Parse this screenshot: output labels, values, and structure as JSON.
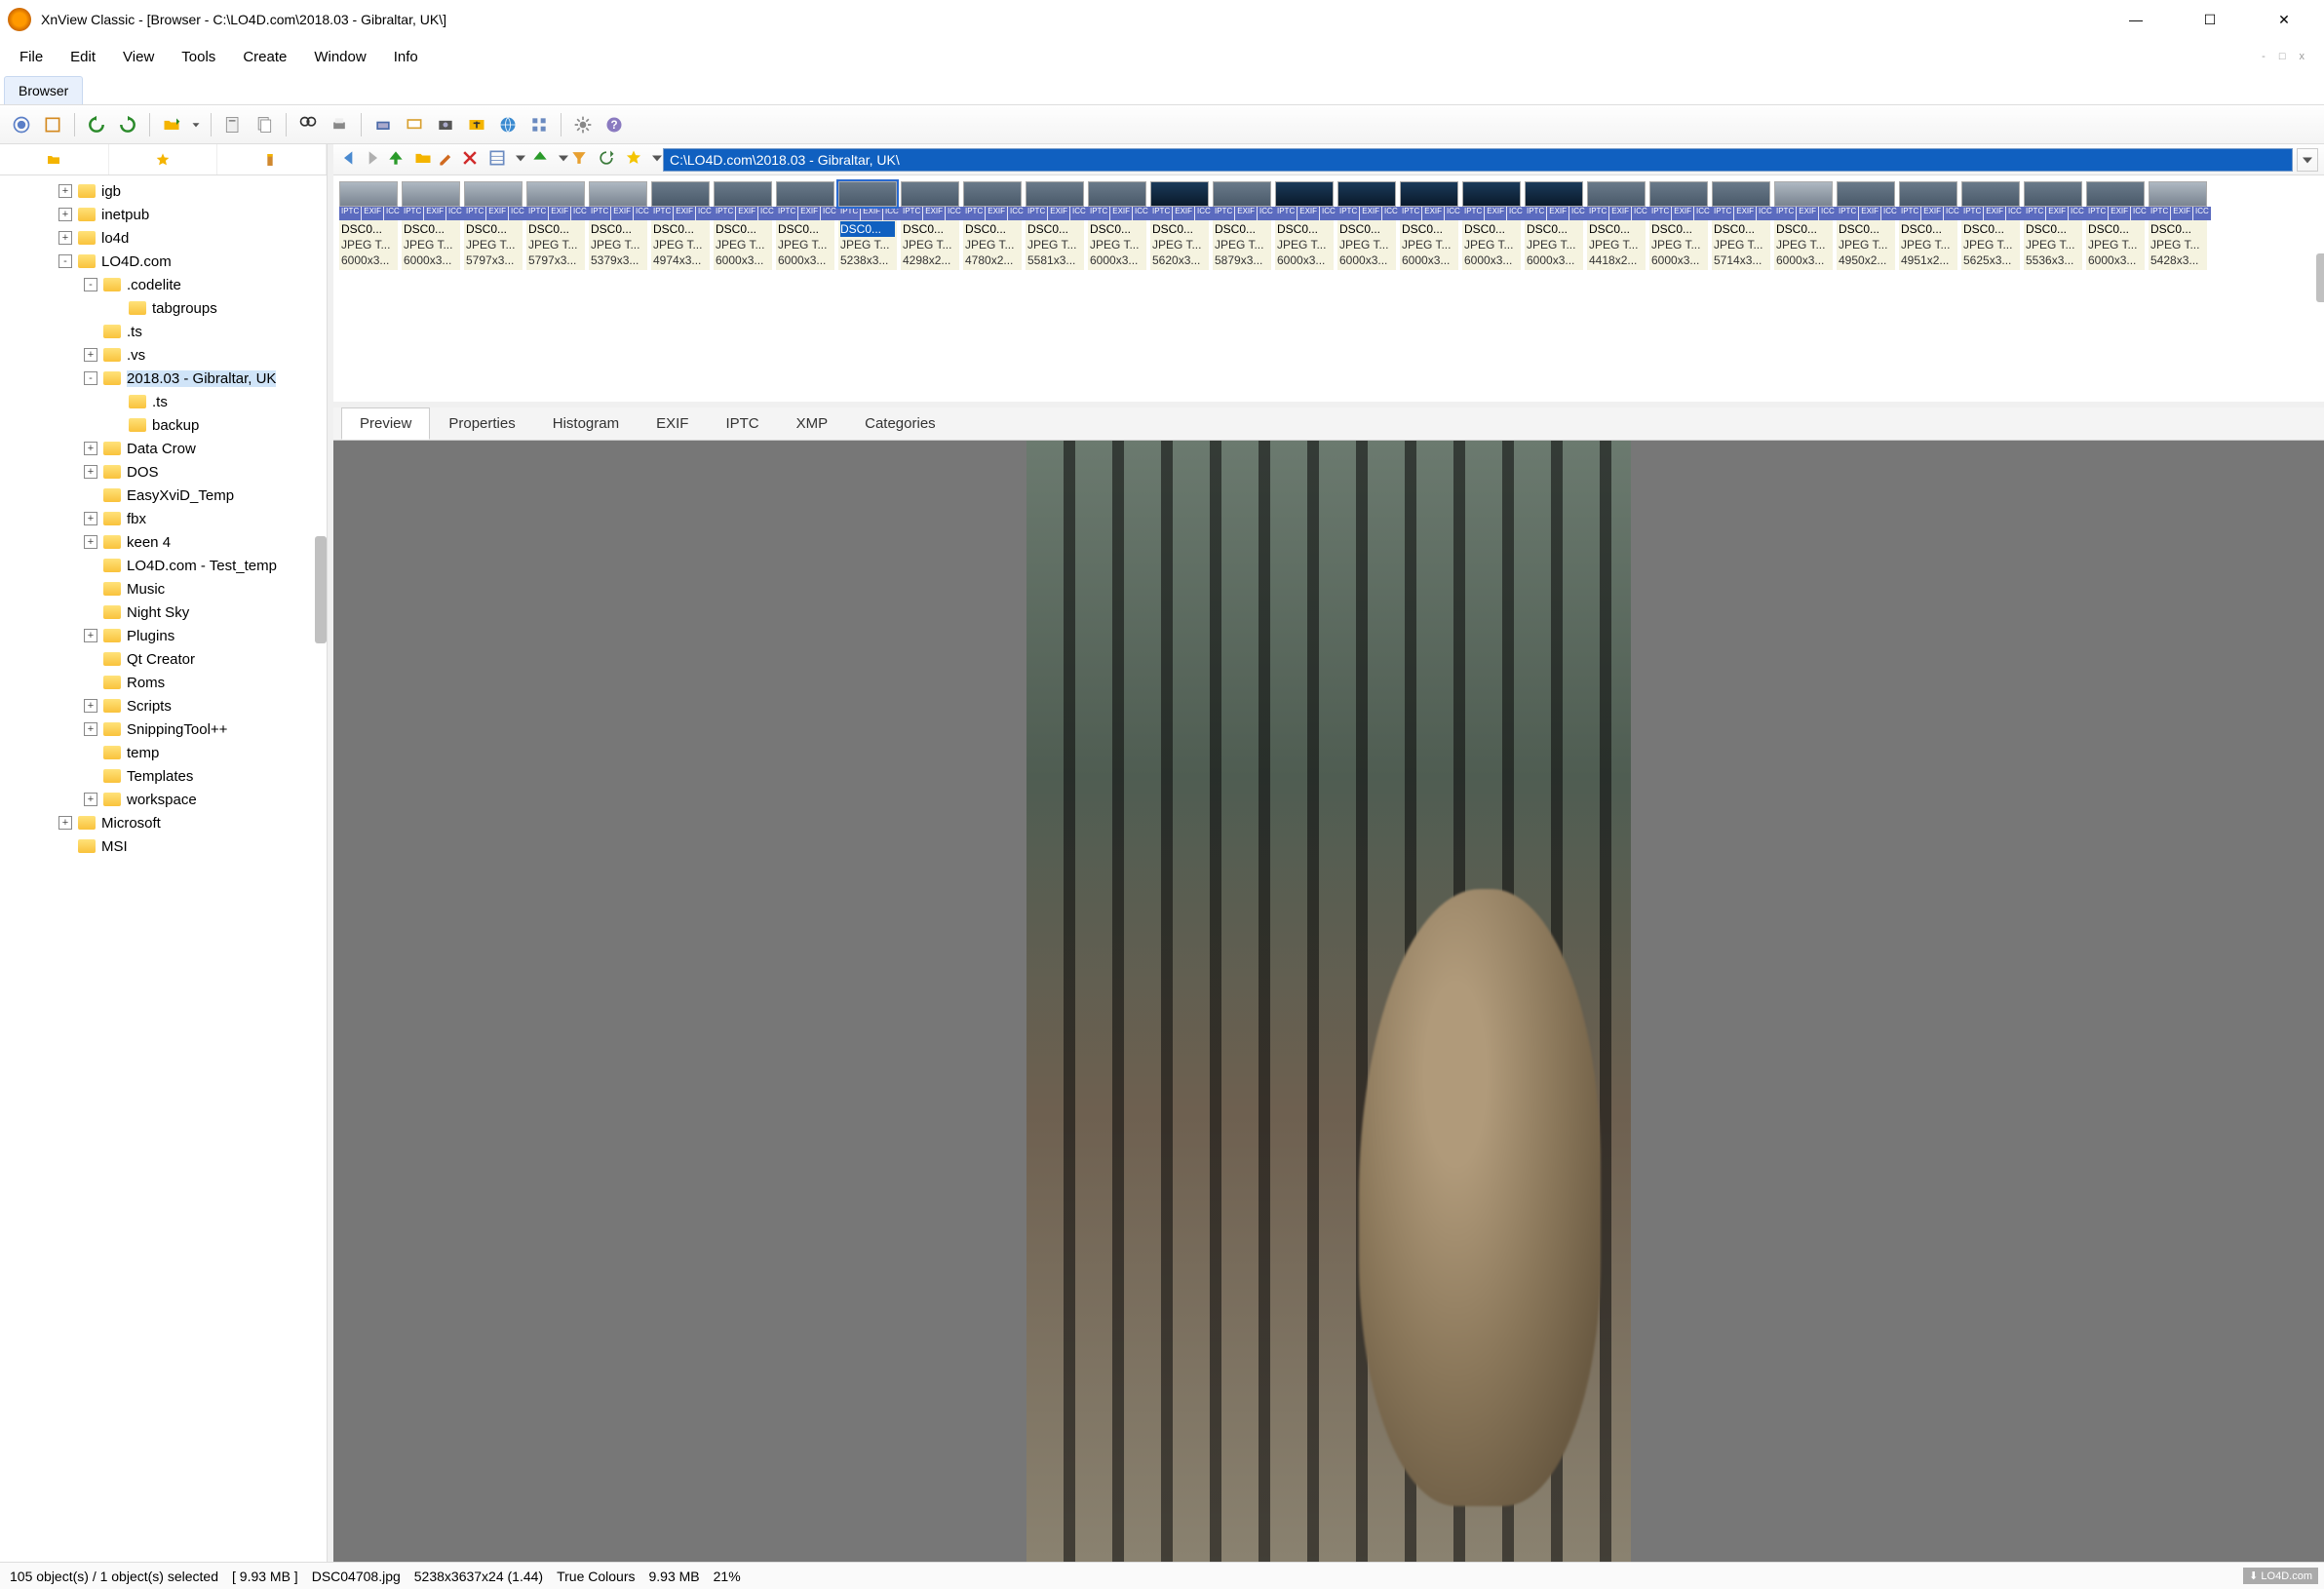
{
  "window": {
    "title": "XnView Classic - [Browser - C:\\LO4D.com\\2018.03 - Gibraltar, UK\\]",
    "minimize": "—",
    "maximize": "☐",
    "close": "✕"
  },
  "menu": {
    "items": [
      "File",
      "Edit",
      "View",
      "Tools",
      "Create",
      "Window",
      "Info"
    ],
    "miniBtns": [
      "-",
      "□",
      "x"
    ]
  },
  "tab": {
    "label": "Browser"
  },
  "toolbarIcons": [
    "view-icon",
    "fullscreen-icon",
    "rotate-ccw-icon",
    "rotate-cw-icon",
    "open-icon",
    "save-icon",
    "copy-icon",
    "search-icon",
    "print-icon",
    "scan-icon",
    "slideshow-icon",
    "capture-icon",
    "convert-icon",
    "web-icon",
    "grid-icon",
    "settings-icon",
    "help-icon"
  ],
  "shortcuts": [
    "folder",
    "star",
    "bookmark"
  ],
  "tree": [
    {
      "indent": 60,
      "toggle": "+",
      "label": "igb"
    },
    {
      "indent": 60,
      "toggle": "+",
      "label": "inetpub"
    },
    {
      "indent": 60,
      "toggle": "+",
      "label": "lo4d"
    },
    {
      "indent": 60,
      "toggle": "-",
      "label": "LO4D.com"
    },
    {
      "indent": 86,
      "toggle": "-",
      "label": ".codelite"
    },
    {
      "indent": 112,
      "toggle": "",
      "label": "tabgroups"
    },
    {
      "indent": 86,
      "toggle": "",
      "label": ".ts"
    },
    {
      "indent": 86,
      "toggle": "+",
      "label": ".vs"
    },
    {
      "indent": 86,
      "toggle": "-",
      "label": "2018.03 - Gibraltar, UK",
      "selected": true
    },
    {
      "indent": 112,
      "toggle": "",
      "label": ".ts"
    },
    {
      "indent": 112,
      "toggle": "",
      "label": "backup"
    },
    {
      "indent": 86,
      "toggle": "+",
      "label": "Data Crow"
    },
    {
      "indent": 86,
      "toggle": "+",
      "label": "DOS"
    },
    {
      "indent": 86,
      "toggle": "",
      "label": "EasyXviD_Temp"
    },
    {
      "indent": 86,
      "toggle": "+",
      "label": "fbx"
    },
    {
      "indent": 86,
      "toggle": "+",
      "label": "keen 4"
    },
    {
      "indent": 86,
      "toggle": "",
      "label": "LO4D.com - Test_temp"
    },
    {
      "indent": 86,
      "toggle": "",
      "label": "Music"
    },
    {
      "indent": 86,
      "toggle": "",
      "label": "Night Sky"
    },
    {
      "indent": 86,
      "toggle": "+",
      "label": "Plugins"
    },
    {
      "indent": 86,
      "toggle": "",
      "label": "Qt Creator"
    },
    {
      "indent": 86,
      "toggle": "",
      "label": "Roms"
    },
    {
      "indent": 86,
      "toggle": "+",
      "label": "Scripts"
    },
    {
      "indent": 86,
      "toggle": "+",
      "label": "SnippingTool++"
    },
    {
      "indent": 86,
      "toggle": "",
      "label": "temp"
    },
    {
      "indent": 86,
      "toggle": "",
      "label": "Templates"
    },
    {
      "indent": 86,
      "toggle": "+",
      "label": "workspace"
    },
    {
      "indent": 60,
      "toggle": "+",
      "label": "Microsoft"
    },
    {
      "indent": 60,
      "toggle": "",
      "label": "MSI"
    }
  ],
  "navIcons": [
    "back-icon",
    "forward-icon",
    "up-icon",
    "open-folder-icon",
    "edit-path-icon",
    "delete-icon",
    "view-mode-icon",
    "sort-icon",
    "filter-icon",
    "refresh-icon",
    "favorite-icon"
  ],
  "path": "C:\\LO4D.com\\2018.03 - Gibraltar, UK\\",
  "badges": [
    "IPTC",
    "EXIF",
    "ICC"
  ],
  "thumbs": [
    {
      "name": "DSC0...",
      "type": "JPEG T...",
      "dim": "6000x3...",
      "cls": "w1"
    },
    {
      "name": "DSC0...",
      "type": "JPEG T...",
      "dim": "6000x3...",
      "cls": "w1"
    },
    {
      "name": "DSC0...",
      "type": "JPEG T...",
      "dim": "5797x3...",
      "cls": "w1"
    },
    {
      "name": "DSC0...",
      "type": "JPEG T...",
      "dim": "5797x3...",
      "cls": "w1"
    },
    {
      "name": "DSC0...",
      "type": "JPEG T...",
      "dim": "5379x3...",
      "cls": "w1"
    },
    {
      "name": "DSC0...",
      "type": "JPEG T...",
      "dim": "4974x3...",
      "cls": ""
    },
    {
      "name": "DSC0...",
      "type": "JPEG T...",
      "dim": "6000x3...",
      "cls": ""
    },
    {
      "name": "DSC0...",
      "type": "JPEG T...",
      "dim": "6000x3...",
      "cls": ""
    },
    {
      "name": "DSC0...",
      "type": "JPEG T...",
      "dim": "5238x3...",
      "cls": "",
      "selected": true
    },
    {
      "name": "DSC0...",
      "type": "JPEG T...",
      "dim": "4298x2...",
      "cls": ""
    },
    {
      "name": "DSC0...",
      "type": "JPEG T...",
      "dim": "4780x2...",
      "cls": ""
    },
    {
      "name": "DSC0...",
      "type": "JPEG T...",
      "dim": "5581x3...",
      "cls": ""
    },
    {
      "name": "DSC0...",
      "type": "JPEG T...",
      "dim": "6000x3...",
      "cls": ""
    },
    {
      "name": "DSC0...",
      "type": "JPEG T...",
      "dim": "5620x3...",
      "cls": "w2"
    },
    {
      "name": "DSC0...",
      "type": "JPEG T...",
      "dim": "5879x3...",
      "cls": ""
    },
    {
      "name": "DSC0...",
      "type": "JPEG T...",
      "dim": "6000x3...",
      "cls": "w2"
    },
    {
      "name": "DSC0...",
      "type": "JPEG T...",
      "dim": "6000x3...",
      "cls": "w2"
    },
    {
      "name": "DSC0...",
      "type": "JPEG T...",
      "dim": "6000x3...",
      "cls": "w2"
    },
    {
      "name": "DSC0...",
      "type": "JPEG T...",
      "dim": "6000x3...",
      "cls": "w2"
    },
    {
      "name": "DSC0...",
      "type": "JPEG T...",
      "dim": "6000x3...",
      "cls": "w2"
    },
    {
      "name": "DSC0...",
      "type": "JPEG T...",
      "dim": "4418x2...",
      "cls": ""
    },
    {
      "name": "DSC0...",
      "type": "JPEG T...",
      "dim": "6000x3...",
      "cls": ""
    },
    {
      "name": "DSC0...",
      "type": "JPEG T...",
      "dim": "5714x3...",
      "cls": ""
    },
    {
      "name": "DSC0...",
      "type": "JPEG T...",
      "dim": "6000x3...",
      "cls": "w1"
    },
    {
      "name": "DSC0...",
      "type": "JPEG T...",
      "dim": "4950x2...",
      "cls": ""
    },
    {
      "name": "DSC0...",
      "type": "JPEG T...",
      "dim": "4951x2...",
      "cls": ""
    },
    {
      "name": "DSC0...",
      "type": "JPEG T...",
      "dim": "5625x3...",
      "cls": ""
    },
    {
      "name": "DSC0...",
      "type": "JPEG T...",
      "dim": "5536x3...",
      "cls": ""
    },
    {
      "name": "DSC0...",
      "type": "JPEG T...",
      "dim": "6000x3...",
      "cls": ""
    },
    {
      "name": "DSC0...",
      "type": "JPEG T...",
      "dim": "5428x3...",
      "cls": "w1"
    }
  ],
  "lowerTabs": [
    "Preview",
    "Properties",
    "Histogram",
    "EXIF",
    "IPTC",
    "XMP",
    "Categories"
  ],
  "activeLowerTab": 0,
  "status": {
    "objects": "105 object(s) / 1 object(s) selected",
    "size": "[ 9.93 MB ]",
    "filename": "DSC04708.jpg",
    "dims": "5238x3637x24 (1.44)",
    "colors": "True Colours",
    "filesize": "9.93 MB",
    "zoom": "21%",
    "brand": "⬇ LO4D.com"
  }
}
